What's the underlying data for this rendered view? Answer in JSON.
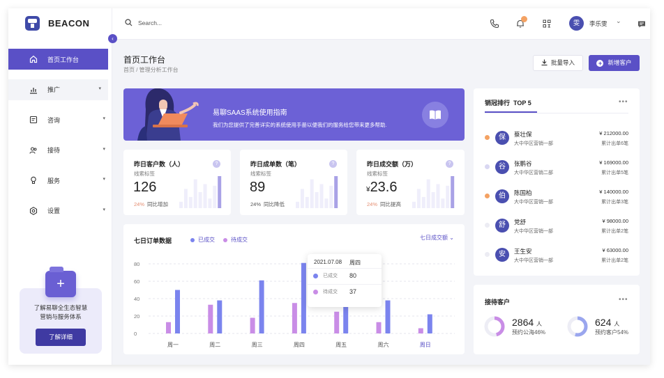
{
  "brand": {
    "name": "BEACON"
  },
  "sidebar": {
    "items": [
      {
        "label": "首页工作台",
        "icon": "home-icon"
      },
      {
        "label": "推广",
        "icon": "bar-chart-icon"
      },
      {
        "label": "咨询",
        "icon": "message-icon"
      },
      {
        "label": "接待",
        "icon": "users-icon"
      },
      {
        "label": "服务",
        "icon": "bulb-icon"
      },
      {
        "label": "设置",
        "icon": "gear-icon"
      }
    ],
    "promo": {
      "line1": "了解易聊全生态智慧",
      "line2": "营销与服务体系",
      "button": "了解详细"
    }
  },
  "topbar": {
    "search_placeholder": "Search...",
    "user_avatar": "雯",
    "user_name": "李乐雯",
    "icons": [
      "phone-icon",
      "bell-icon",
      "apps-icon",
      "chat-icon"
    ],
    "accent": "#5a50c6"
  },
  "page": {
    "title": "首页工作台",
    "breadcrumb": "首页 / 管理分析工作台"
  },
  "actions": {
    "import": "批量导入",
    "new_customer": "新增客户"
  },
  "banner": {
    "title": "易聊SAAS系统使用指南",
    "subtitle": "我们为您提供了完善详实的系统使用手册以便我们的服务给您带来更多帮助."
  },
  "stats": [
    {
      "title": "昨日客户数（人）",
      "sub": "线索标签",
      "value": "126",
      "prefix": "",
      "pct": "24%",
      "note": "同比增加",
      "pct_color": "#e58f72",
      "bars": [
        0.2,
        0.6,
        0.35,
        0.9,
        0.5,
        0.75,
        0.3,
        0.7,
        1.0
      ]
    },
    {
      "title": "昨日成单数（笔）",
      "sub": "线索标签",
      "value": "89",
      "prefix": "",
      "pct": "24%",
      "note": "同比降低",
      "pct_color": "#555555",
      "bars": [
        0.2,
        0.6,
        0.35,
        0.9,
        0.5,
        0.75,
        0.3,
        0.7,
        1.0
      ]
    },
    {
      "title": "昨日成交额（万）",
      "sub": "线索标签",
      "value": "23.6",
      "prefix": "¥",
      "pct": "24%",
      "note": "同比提高",
      "pct_color": "#e58f72",
      "bars": [
        0.2,
        0.6,
        0.35,
        0.9,
        0.5,
        0.75,
        0.3,
        0.7,
        1.0
      ]
    }
  ],
  "orders": {
    "title": "七日订单数据",
    "legend": [
      "已成交",
      "待成交"
    ],
    "selector": "七日成交额",
    "tooltip": {
      "date": "2021.07.08",
      "day": "周四",
      "done_label": "已成交",
      "done": "80",
      "pending_label": "待成交",
      "pending": "37"
    }
  },
  "chart_data": {
    "type": "bar",
    "categories": [
      "周一",
      "周二",
      "周三",
      "周四",
      "周五",
      "周六",
      "周日"
    ],
    "series": [
      {
        "name": "已成交",
        "color": "#7b84ee",
        "values": [
          50,
          38,
          61,
          81,
          40,
          38,
          22
        ]
      },
      {
        "name": "待成交",
        "color": "#c98de6",
        "values": [
          13,
          33,
          18,
          35,
          25,
          13,
          6
        ]
      }
    ],
    "yticks": [
      0,
      20,
      40,
      60,
      80
    ],
    "ylim": [
      0,
      80
    ],
    "grid": true,
    "highlight_category": "周日"
  },
  "ranking": {
    "title": "销冠排行",
    "tab": "TOP 5",
    "more": "•••",
    "rows": [
      {
        "avatar": "保",
        "name": "蔡壮保",
        "dept": "大中华区营销一部",
        "amount": "¥ 212000.00",
        "count": "累计出单6笔",
        "dot": "#f4a263"
      },
      {
        "avatar": "谷",
        "name": "张鹏谷",
        "dept": "大中华区营销二部",
        "amount": "¥ 169000.00",
        "count": "累计出单5笔",
        "dot": "#d9d7f2"
      },
      {
        "avatar": "伯",
        "name": "陈国柏",
        "dept": "大中华区营销一部",
        "amount": "¥ 140000.00",
        "count": "累计出单3笔",
        "dot": "#f4a263"
      },
      {
        "avatar": "舒",
        "name": "党舒",
        "dept": "大中华区营销一部",
        "amount": "¥ 98000.00",
        "count": "累计出单2笔",
        "dot": "#ececf3"
      },
      {
        "avatar": "安",
        "name": "王生安",
        "dept": "大中华区营销一部",
        "amount": "¥ 63000.00",
        "count": "累计出单2笔",
        "dot": "#ececf3"
      }
    ]
  },
  "reception": {
    "title": "接待客户",
    "more": "•••",
    "items": [
      {
        "value": "2864",
        "unit": "人",
        "label": "预约公海46%",
        "percent": 46,
        "color": "#c98de6"
      },
      {
        "value": "624",
        "unit": "人",
        "label": "预约客户54%",
        "percent": 54,
        "color": "#9aa6ee"
      }
    ]
  }
}
